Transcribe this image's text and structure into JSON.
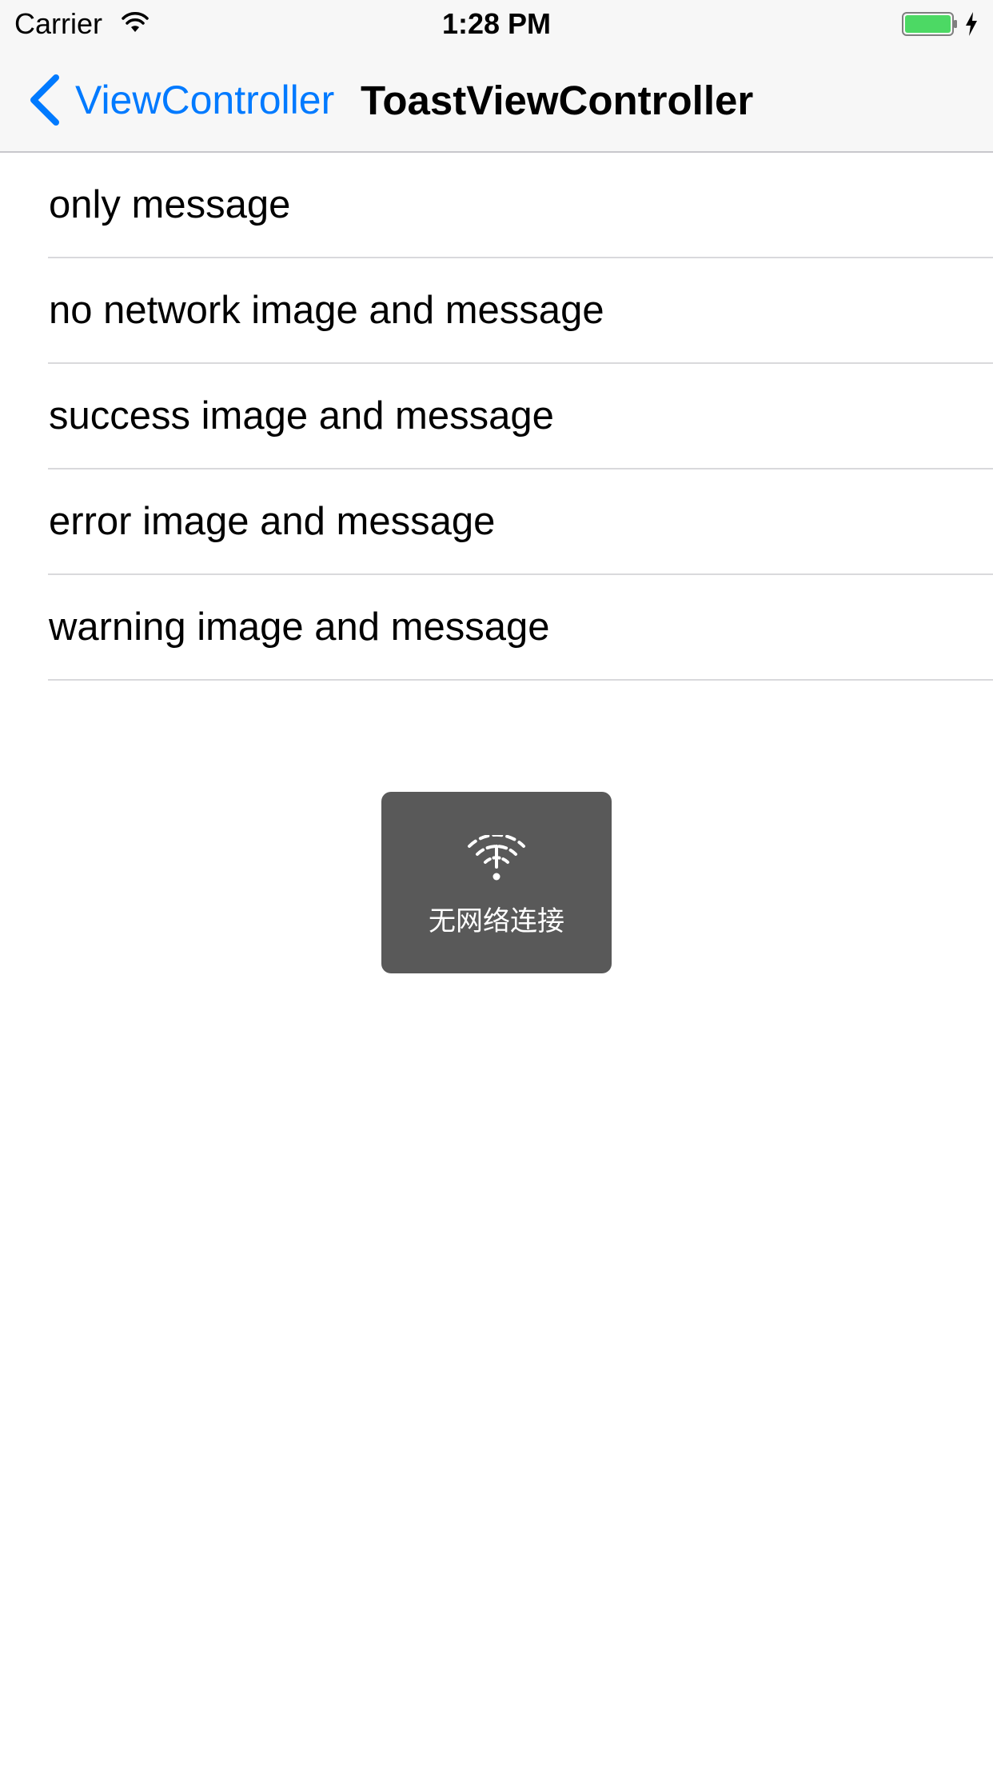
{
  "status_bar": {
    "carrier": "Carrier",
    "time": "1:28 PM",
    "icons": [
      "wifi-icon",
      "battery-icon",
      "charging-bolt-icon"
    ],
    "battery_color": "#4cd964"
  },
  "nav_bar": {
    "back_label": "ViewController",
    "title": "ToastViewController",
    "accent_color": "#007aff",
    "icons": [
      "chevron-left-icon"
    ]
  },
  "table": {
    "rows": [
      {
        "label": "only message"
      },
      {
        "label": "no network image and message"
      },
      {
        "label": "success image and message"
      },
      {
        "label": "error image and message"
      },
      {
        "label": "warning image and message"
      }
    ]
  },
  "toast": {
    "icon": "no-network-icon",
    "message": "无网络连接",
    "background_color": "#595959"
  }
}
